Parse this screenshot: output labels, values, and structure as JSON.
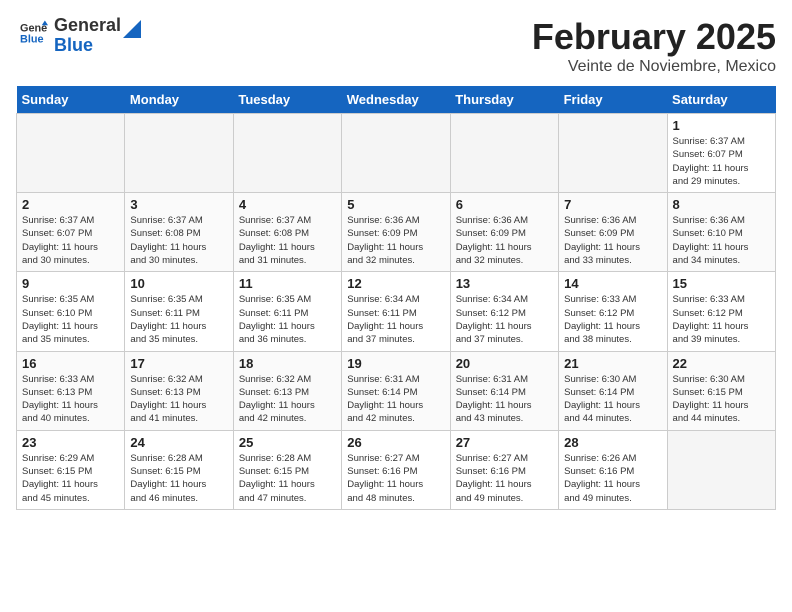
{
  "header": {
    "logo_line1": "General",
    "logo_line2": "Blue",
    "month": "February 2025",
    "location": "Veinte de Noviembre, Mexico"
  },
  "weekdays": [
    "Sunday",
    "Monday",
    "Tuesday",
    "Wednesday",
    "Thursday",
    "Friday",
    "Saturday"
  ],
  "weeks": [
    [
      {
        "day": "",
        "info": ""
      },
      {
        "day": "",
        "info": ""
      },
      {
        "day": "",
        "info": ""
      },
      {
        "day": "",
        "info": ""
      },
      {
        "day": "",
        "info": ""
      },
      {
        "day": "",
        "info": ""
      },
      {
        "day": "1",
        "info": "Sunrise: 6:37 AM\nSunset: 6:07 PM\nDaylight: 11 hours\nand 29 minutes."
      }
    ],
    [
      {
        "day": "2",
        "info": "Sunrise: 6:37 AM\nSunset: 6:07 PM\nDaylight: 11 hours\nand 30 minutes."
      },
      {
        "day": "3",
        "info": "Sunrise: 6:37 AM\nSunset: 6:08 PM\nDaylight: 11 hours\nand 30 minutes."
      },
      {
        "day": "4",
        "info": "Sunrise: 6:37 AM\nSunset: 6:08 PM\nDaylight: 11 hours\nand 31 minutes."
      },
      {
        "day": "5",
        "info": "Sunrise: 6:36 AM\nSunset: 6:09 PM\nDaylight: 11 hours\nand 32 minutes."
      },
      {
        "day": "6",
        "info": "Sunrise: 6:36 AM\nSunset: 6:09 PM\nDaylight: 11 hours\nand 32 minutes."
      },
      {
        "day": "7",
        "info": "Sunrise: 6:36 AM\nSunset: 6:09 PM\nDaylight: 11 hours\nand 33 minutes."
      },
      {
        "day": "8",
        "info": "Sunrise: 6:36 AM\nSunset: 6:10 PM\nDaylight: 11 hours\nand 34 minutes."
      }
    ],
    [
      {
        "day": "9",
        "info": "Sunrise: 6:35 AM\nSunset: 6:10 PM\nDaylight: 11 hours\nand 35 minutes."
      },
      {
        "day": "10",
        "info": "Sunrise: 6:35 AM\nSunset: 6:11 PM\nDaylight: 11 hours\nand 35 minutes."
      },
      {
        "day": "11",
        "info": "Sunrise: 6:35 AM\nSunset: 6:11 PM\nDaylight: 11 hours\nand 36 minutes."
      },
      {
        "day": "12",
        "info": "Sunrise: 6:34 AM\nSunset: 6:11 PM\nDaylight: 11 hours\nand 37 minutes."
      },
      {
        "day": "13",
        "info": "Sunrise: 6:34 AM\nSunset: 6:12 PM\nDaylight: 11 hours\nand 37 minutes."
      },
      {
        "day": "14",
        "info": "Sunrise: 6:33 AM\nSunset: 6:12 PM\nDaylight: 11 hours\nand 38 minutes."
      },
      {
        "day": "15",
        "info": "Sunrise: 6:33 AM\nSunset: 6:12 PM\nDaylight: 11 hours\nand 39 minutes."
      }
    ],
    [
      {
        "day": "16",
        "info": "Sunrise: 6:33 AM\nSunset: 6:13 PM\nDaylight: 11 hours\nand 40 minutes."
      },
      {
        "day": "17",
        "info": "Sunrise: 6:32 AM\nSunset: 6:13 PM\nDaylight: 11 hours\nand 41 minutes."
      },
      {
        "day": "18",
        "info": "Sunrise: 6:32 AM\nSunset: 6:13 PM\nDaylight: 11 hours\nand 42 minutes."
      },
      {
        "day": "19",
        "info": "Sunrise: 6:31 AM\nSunset: 6:14 PM\nDaylight: 11 hours\nand 42 minutes."
      },
      {
        "day": "20",
        "info": "Sunrise: 6:31 AM\nSunset: 6:14 PM\nDaylight: 11 hours\nand 43 minutes."
      },
      {
        "day": "21",
        "info": "Sunrise: 6:30 AM\nSunset: 6:14 PM\nDaylight: 11 hours\nand 44 minutes."
      },
      {
        "day": "22",
        "info": "Sunrise: 6:30 AM\nSunset: 6:15 PM\nDaylight: 11 hours\nand 44 minutes."
      }
    ],
    [
      {
        "day": "23",
        "info": "Sunrise: 6:29 AM\nSunset: 6:15 PM\nDaylight: 11 hours\nand 45 minutes."
      },
      {
        "day": "24",
        "info": "Sunrise: 6:28 AM\nSunset: 6:15 PM\nDaylight: 11 hours\nand 46 minutes."
      },
      {
        "day": "25",
        "info": "Sunrise: 6:28 AM\nSunset: 6:15 PM\nDaylight: 11 hours\nand 47 minutes."
      },
      {
        "day": "26",
        "info": "Sunrise: 6:27 AM\nSunset: 6:16 PM\nDaylight: 11 hours\nand 48 minutes."
      },
      {
        "day": "27",
        "info": "Sunrise: 6:27 AM\nSunset: 6:16 PM\nDaylight: 11 hours\nand 49 minutes."
      },
      {
        "day": "28",
        "info": "Sunrise: 6:26 AM\nSunset: 6:16 PM\nDaylight: 11 hours\nand 49 minutes."
      },
      {
        "day": "",
        "info": ""
      }
    ]
  ]
}
